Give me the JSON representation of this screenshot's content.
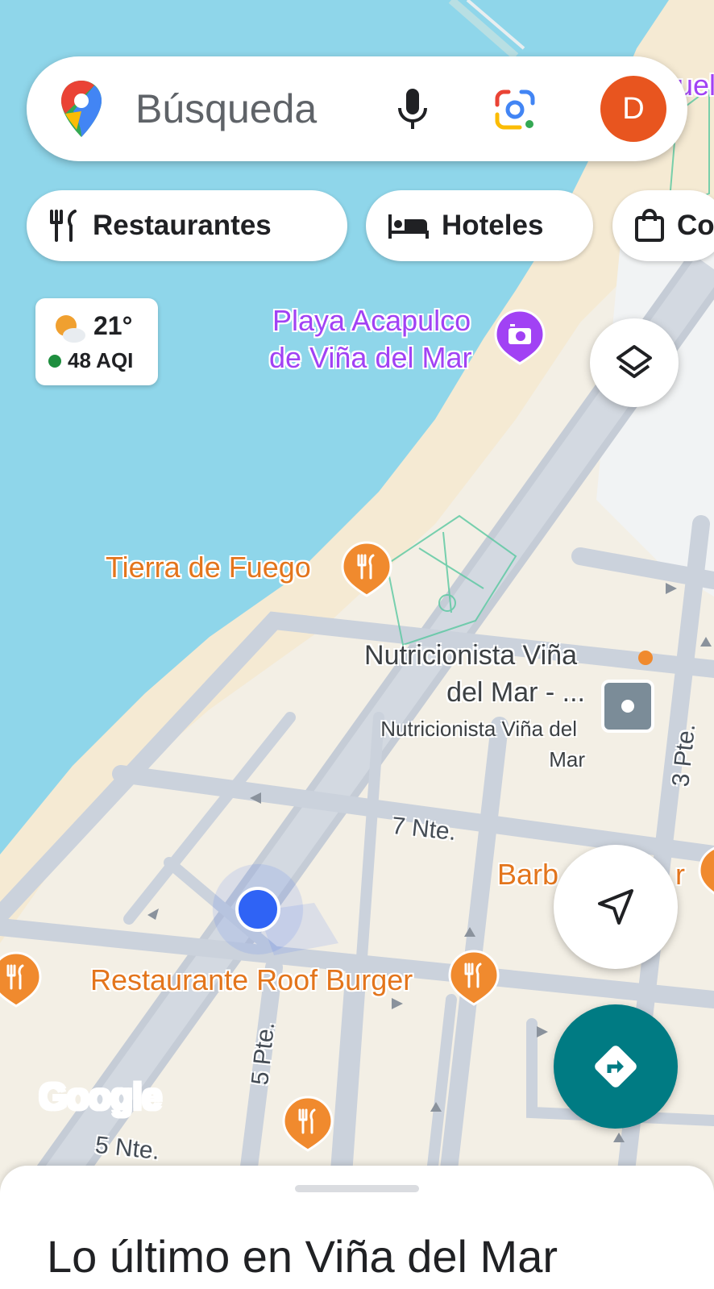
{
  "colors": {
    "water": "#8fd6ea",
    "land": "#f5ead3",
    "road": "#cbd2dc",
    "park_line": "#58c8a0",
    "accent_orange": "#f08a2e",
    "avatar_bg": "#e8551f",
    "directions_fab": "#007b83",
    "location_dot": "#2f63f5"
  },
  "search": {
    "placeholder": "Búsqueda",
    "avatar_letter": "D",
    "icons": [
      "google-maps-pin-icon",
      "microphone-icon",
      "google-lens-icon"
    ]
  },
  "chips": [
    {
      "label": "Restaurantes",
      "icon": "fork-knife-icon"
    },
    {
      "label": "Hoteles",
      "icon": "bed-icon"
    },
    {
      "label": "Co",
      "icon": "shopping-bag-icon"
    }
  ],
  "weather": {
    "temp": "21°",
    "aqi": "48 AQI"
  },
  "map_labels": {
    "top_right_fragment": "uel",
    "playa_line1": "Playa Acapulco",
    "playa_line2": "de Viña del Mar",
    "tierra": "Tierra de Fuego",
    "nutri_line1": "Nutricionista Viña",
    "nutri_line2": "del Mar - ...",
    "nutri_sub1": "Nutricionista Viña del",
    "nutri_sub2": "Mar",
    "street_7nte": "7 Nte.",
    "street_3pte": "3 Pte.",
    "street_5pte": "5 Pte.",
    "street_5nte": "5 Nte.",
    "barb_left": "Barb",
    "barb_right": "r",
    "roof_burger": "Restaurante Roof Burger",
    "google_logo": "Google"
  },
  "bottom_sheet": {
    "title": "Lo último en Viña del Mar"
  }
}
